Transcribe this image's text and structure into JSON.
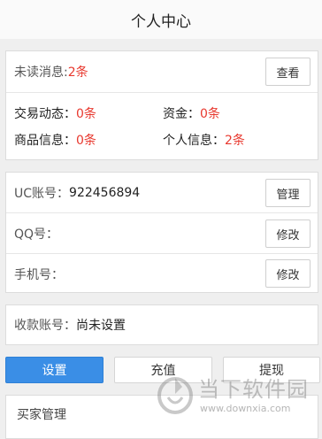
{
  "header": {
    "title": "个人中心"
  },
  "messages": {
    "unread_label": "未读消息:",
    "unread_value": "2条",
    "view_button": "查看",
    "trade_label": "交易动态：",
    "trade_value": "0条",
    "funds_label": "资金：",
    "funds_value": "0条",
    "product_label": "商品信息：",
    "product_value": "0条",
    "personal_label": "个人信息：",
    "personal_value": "2条"
  },
  "account": {
    "uc_label": "UC账号：",
    "uc_value": "922456894",
    "manage_button": "管理",
    "qq_label": "QQ号：",
    "qq_value": "",
    "qq_button": "修改",
    "phone_label": "手机号：",
    "phone_value": "",
    "phone_button": "修改"
  },
  "payment": {
    "label": "收款账号：",
    "value": "尚未设置"
  },
  "actions": {
    "settings": "设置",
    "recharge": "充值",
    "withdraw": "提现"
  },
  "buyer": {
    "label": "买家管理"
  },
  "watermark": {
    "name": "当下软件园",
    "url": "www.downxia.com"
  },
  "colors": {
    "accent": "#3a8ee6",
    "alert": "#e8392f"
  }
}
